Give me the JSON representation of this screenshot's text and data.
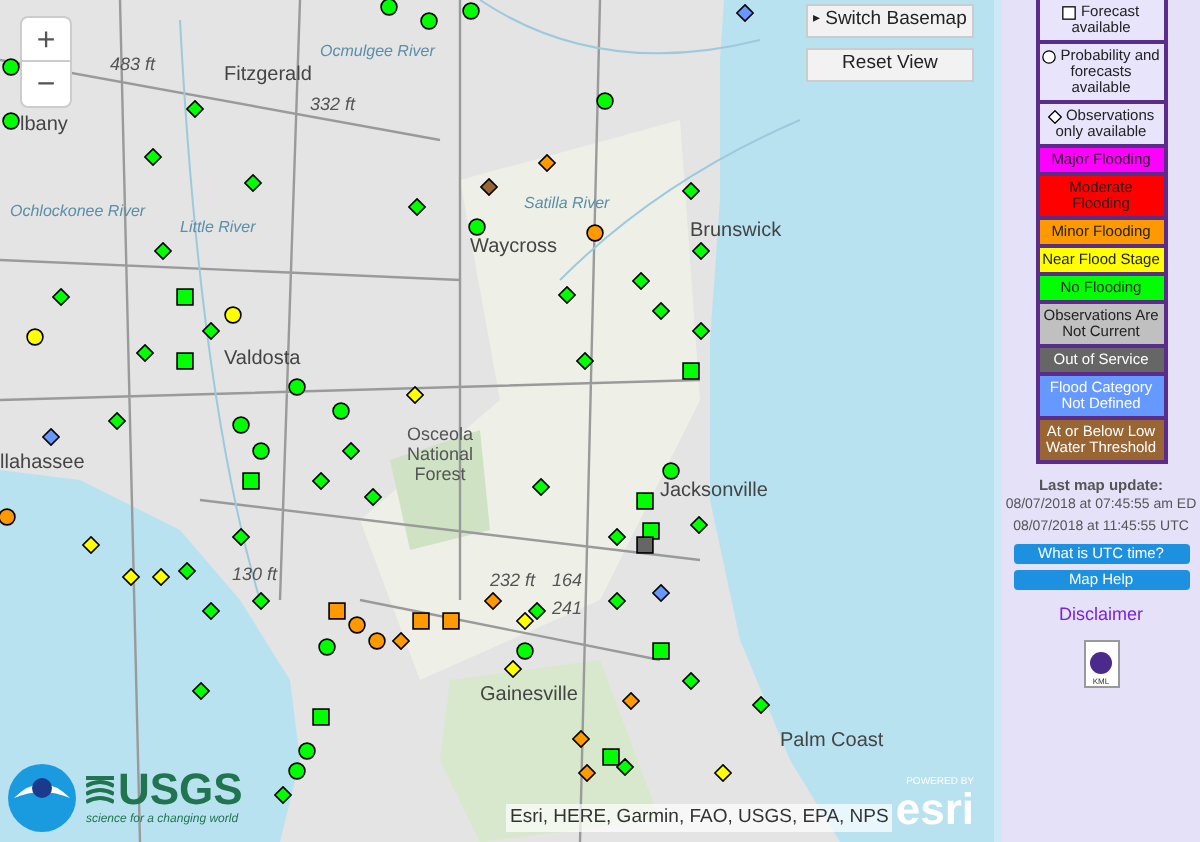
{
  "map": {
    "zoom_in": "+",
    "zoom_out": "−",
    "switch_basemap_icon": "▸",
    "switch_basemap": "Switch Basemap",
    "reset_view": "Reset View",
    "labels": [
      {
        "text": "Fitzgerald",
        "kind": "city"
      },
      {
        "text": "lbany",
        "kind": "city"
      },
      {
        "text": "483 ft",
        "kind": "elevation"
      },
      {
        "text": "332 ft",
        "kind": "elevation"
      },
      {
        "text": "Waycross",
        "kind": "city"
      },
      {
        "text": "Brunswick",
        "kind": "city"
      },
      {
        "text": "Valdosta",
        "kind": "city"
      },
      {
        "text": "Osceola National Forest",
        "kind": "park"
      },
      {
        "text": "Jacksonville",
        "kind": "city"
      },
      {
        "text": "llahassee",
        "kind": "city"
      },
      {
        "text": "130 ft",
        "kind": "elevation"
      },
      {
        "text": "232 ft",
        "kind": "elevation"
      },
      {
        "text": "164",
        "kind": "elevation"
      },
      {
        "text": "241",
        "kind": "elevation"
      },
      {
        "text": "Gainesville",
        "kind": "city"
      },
      {
        "text": "Palm Coast",
        "kind": "city"
      },
      {
        "text": "Satilla River",
        "kind": "river"
      },
      {
        "text": "Little River",
        "kind": "river"
      },
      {
        "text": "Ochlockonee River",
        "kind": "river"
      },
      {
        "text": "Ocmulgee River",
        "kind": "river"
      }
    ],
    "markers": [
      {
        "kind": "circle",
        "color": "#00ff00"
      },
      {
        "kind": "circle",
        "color": "#00ff00"
      },
      {
        "kind": "diamond",
        "color": "#00ff00"
      },
      {
        "kind": "diamond",
        "color": "#00ff00"
      },
      {
        "kind": "diamond",
        "color": "#00ff00"
      },
      {
        "kind": "diamond",
        "color": "#00ff00"
      },
      {
        "kind": "diamond",
        "color": "#00ff00"
      },
      {
        "kind": "square",
        "color": "#00ff00"
      },
      {
        "kind": "circle",
        "color": "#ffff00"
      },
      {
        "kind": "diamond",
        "color": "#00ff00"
      },
      {
        "kind": "circle",
        "color": "#ffff00"
      },
      {
        "kind": "diamond",
        "color": "#00ff00"
      },
      {
        "kind": "square",
        "color": "#00ff00"
      },
      {
        "kind": "circle",
        "color": "#00ff00"
      },
      {
        "kind": "circle",
        "color": "#00ff00"
      },
      {
        "kind": "circle",
        "color": "#00ff00"
      },
      {
        "kind": "circle",
        "color": "#00ff00"
      },
      {
        "kind": "diamond",
        "color": "#ff9900"
      },
      {
        "kind": "diamond",
        "color": "#996633"
      },
      {
        "kind": "circle",
        "color": "#00ff00"
      },
      {
        "kind": "circle",
        "color": "#ff9900"
      },
      {
        "kind": "diamond",
        "color": "#00ff00"
      },
      {
        "kind": "diamond",
        "color": "#00ff00"
      },
      {
        "kind": "diamond",
        "color": "#00ff00"
      },
      {
        "kind": "diamond",
        "color": "#00ff00"
      },
      {
        "kind": "diamond",
        "color": "#00ff00"
      },
      {
        "kind": "diamond",
        "color": "#00ff00"
      },
      {
        "kind": "diamond",
        "color": "#00ff00"
      },
      {
        "kind": "square",
        "color": "#00ff00"
      },
      {
        "kind": "diamond",
        "color": "#00ff00"
      },
      {
        "kind": "circle",
        "color": "#00ff00"
      },
      {
        "kind": "diamond",
        "color": "#ffff00"
      },
      {
        "kind": "circle",
        "color": "#00ff00"
      },
      {
        "kind": "diamond",
        "color": "#00ff00"
      },
      {
        "kind": "circle",
        "color": "#00ff00"
      },
      {
        "kind": "square",
        "color": "#00ff00"
      },
      {
        "kind": "diamond",
        "color": "#6699ff"
      },
      {
        "kind": "circle",
        "color": "#00ff00"
      },
      {
        "kind": "diamond",
        "color": "#00ff00"
      },
      {
        "kind": "diamond",
        "color": "#00ff00"
      },
      {
        "kind": "diamond",
        "color": "#00ff00"
      },
      {
        "kind": "diamond",
        "color": "#00ff00"
      },
      {
        "kind": "square",
        "color": "#00ff00"
      },
      {
        "kind": "circle",
        "color": "#00ff00"
      },
      {
        "kind": "square",
        "color": "#00ff00"
      },
      {
        "kind": "diamond",
        "color": "#00ff00"
      },
      {
        "kind": "diamond",
        "color": "#00ff00"
      },
      {
        "kind": "square",
        "color": "#666666"
      },
      {
        "kind": "circle",
        "color": "#ff9900"
      },
      {
        "kind": "diamond",
        "color": "#ffff00"
      },
      {
        "kind": "diamond",
        "color": "#ffff00"
      },
      {
        "kind": "diamond",
        "color": "#ffff00"
      },
      {
        "kind": "diamond",
        "color": "#00ff00"
      },
      {
        "kind": "diamond",
        "color": "#00ff00"
      },
      {
        "kind": "diamond",
        "color": "#00ff00"
      },
      {
        "kind": "diamond",
        "color": "#00ff00"
      },
      {
        "kind": "square",
        "color": "#ff9900"
      },
      {
        "kind": "circle",
        "color": "#ff9900"
      },
      {
        "kind": "circle",
        "color": "#ff9900"
      },
      {
        "kind": "diamond",
        "color": "#ff9900"
      },
      {
        "kind": "square",
        "color": "#ff9900"
      },
      {
        "kind": "square",
        "color": "#ff9900"
      },
      {
        "kind": "diamond",
        "color": "#ff9900"
      },
      {
        "kind": "diamond",
        "color": "#ffff00"
      },
      {
        "kind": "diamond",
        "color": "#00ff00"
      },
      {
        "kind": "circle",
        "color": "#00ff00"
      },
      {
        "kind": "diamond",
        "color": "#ffff00"
      },
      {
        "kind": "diamond",
        "color": "#00ff00"
      },
      {
        "kind": "diamond",
        "color": "#6699ff"
      },
      {
        "kind": "square",
        "color": "#00ff00"
      },
      {
        "kind": "circle",
        "color": "#00ff00"
      },
      {
        "kind": "diamond",
        "color": "#00ff00"
      },
      {
        "kind": "square",
        "color": "#00ff00"
      },
      {
        "kind": "diamond",
        "color": "#ff9900"
      },
      {
        "kind": "diamond",
        "color": "#00ff00"
      },
      {
        "kind": "diamond",
        "color": "#00ff00"
      },
      {
        "kind": "diamond",
        "color": "#ff9900"
      },
      {
        "kind": "square",
        "color": "#00ff00"
      },
      {
        "kind": "diamond",
        "color": "#00ff00"
      },
      {
        "kind": "diamond",
        "color": "#ff9900"
      },
      {
        "kind": "diamond",
        "color": "#ffff00"
      },
      {
        "kind": "circle",
        "color": "#00ff00"
      },
      {
        "kind": "circle",
        "color": "#00ff00"
      },
      {
        "kind": "diamond",
        "color": "#00ff00"
      },
      {
        "kind": "diamond",
        "color": "#6699ff"
      }
    ],
    "usgs": "USGS",
    "usgs_tagline": "science for a changing world",
    "attribution": "Esri, HERE, Garmin, FAO, USGS, EPA, NPS",
    "esri_powered": "POWERED BY",
    "esri": "esri"
  },
  "legend": {
    "shapes": [
      {
        "kind": "square",
        "label": "Forecast available"
      },
      {
        "kind": "circle",
        "label": "Probability and forecasts available"
      },
      {
        "kind": "diamond",
        "label": "Observations only available"
      }
    ],
    "categories": [
      {
        "label": "Major Flooding",
        "color": "#ff00ff",
        "dark_text": true
      },
      {
        "label": "Moderate Flooding",
        "color": "#ff0000",
        "dark_text": true
      },
      {
        "label": "Minor Flooding",
        "color": "#ff9900",
        "dark_text": true
      },
      {
        "label": "Near Flood Stage",
        "color": "#ffff00",
        "dark_text": true
      },
      {
        "label": "No Flooding",
        "color": "#00ff00",
        "dark_text": true
      },
      {
        "label": "Observations Are Not Current",
        "color": "#c0c0c0",
        "dark_text": true
      },
      {
        "label": "Out of Service",
        "color": "#666666",
        "dark_text": false
      },
      {
        "label": "Flood Category Not Defined",
        "color": "#6699ff",
        "dark_text": false
      },
      {
        "label": "At or Below Low Water Threshold",
        "color": "#996633",
        "dark_text": false
      }
    ]
  },
  "update": {
    "heading": "Last map update:",
    "local": "08/07/2018 at 07:45:55 am ED",
    "utc": "08/07/2018 at 11:45:55 UTC"
  },
  "buttons": [
    "What is UTC time?",
    "Map Help"
  ],
  "disclaimer": "Disclaimer",
  "kml": "KML"
}
